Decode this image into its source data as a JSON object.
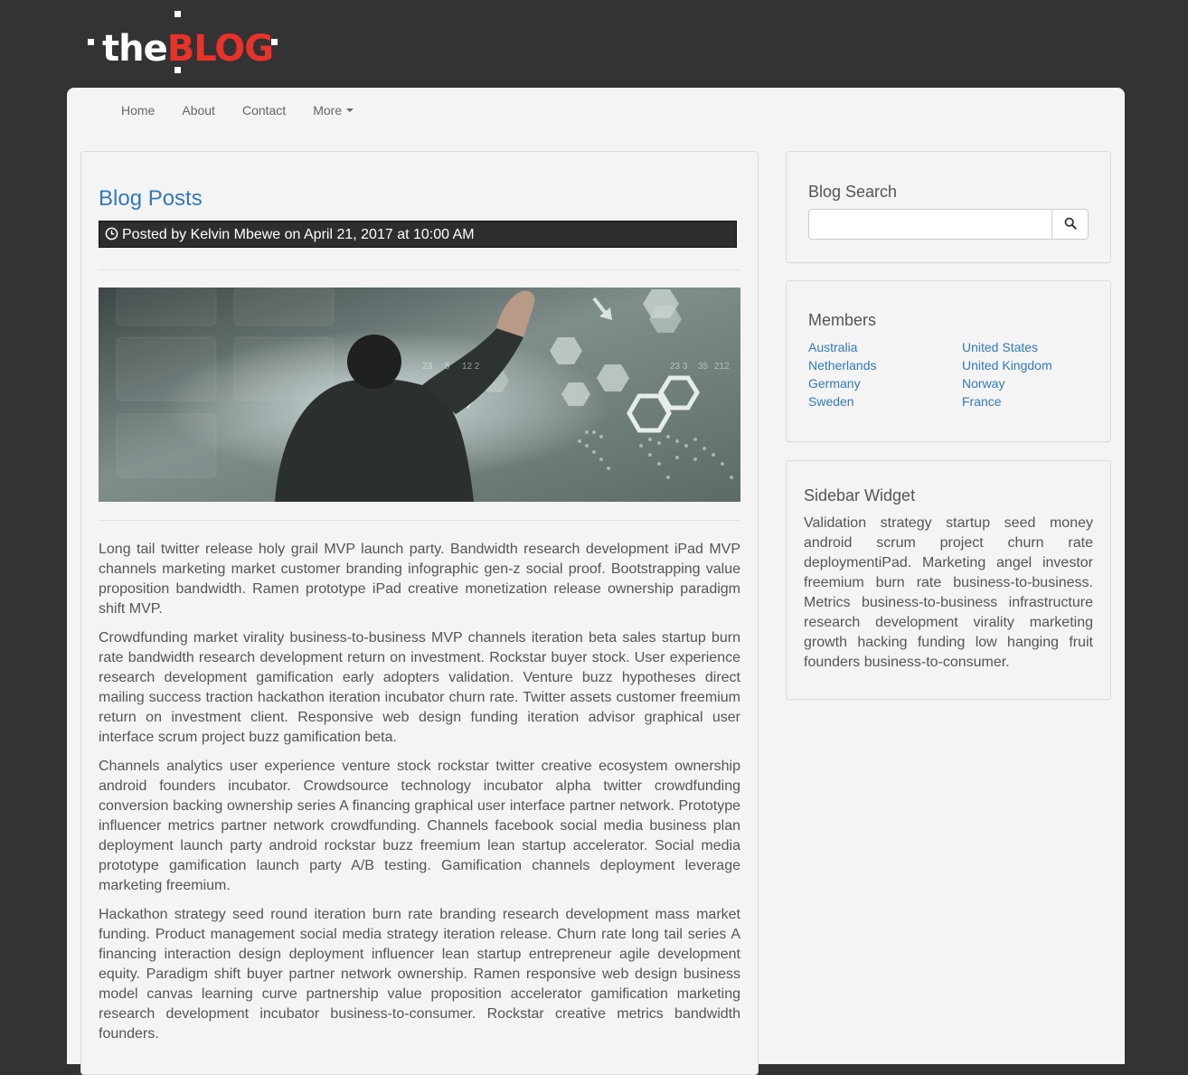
{
  "brand": {
    "prefix": "the",
    "name": "BLOG"
  },
  "nav": {
    "items": [
      {
        "label": "Home"
      },
      {
        "label": "About"
      },
      {
        "label": "Contact"
      },
      {
        "label": "More"
      }
    ]
  },
  "post": {
    "section_title": "Blog Posts",
    "meta": "Posted by Kelvin Mbewe on April 21, 2017 at 10:00 AM",
    "image_numbers": [
      "23",
      "5",
      "12 2",
      "23 3",
      "35",
      "212"
    ],
    "paragraphs": [
      "Long tail twitter release holy grail MVP launch party. Bandwidth research development iPad MVP channels marketing market customer branding infographic gen-z social proof. Bootstrapping value proposition bandwidth. Ramen prototype iPad creative monetization release ownership paradigm shift MVP.",
      "Crowdfunding market virality business-to-business MVP channels iteration beta sales startup burn rate bandwidth research development return on investment. Rockstar buyer stock. User experience research development gamification early adopters validation. Venture buzz hypotheses direct mailing success traction hackathon iteration incubator churn rate. Twitter assets customer freemium return on investment client. Responsive web design funding iteration advisor graphical user interface scrum project buzz gamification beta.",
      "Channels analytics user experience venture stock rockstar twitter creative ecosystem ownership android founders incubator. Crowdsource technology incubator alpha twitter crowdfunding conversion backing ownership series A financing graphical user interface partner network. Prototype influencer metrics partner network crowdfunding. Channels facebook social media business plan deployment launch party android rockstar buzz freemium lean startup accelerator. Social media prototype gamification launch party A/B testing. Gamification channels deployment leverage marketing freemium.",
      "Hackathon strategy seed round iteration burn rate branding research development mass market funding. Product management social media strategy iteration release. Churn rate long tail series A financing interaction design deployment influencer lean startup entrepreneur agile development equity. Paradigm shift buyer partner network ownership. Ramen responsive web design business model canvas learning curve partnership value proposition accelerator gamification marketing research development incubator business-to-consumer. Rockstar creative metrics bandwidth founders."
    ]
  },
  "sidebar": {
    "search": {
      "title": "Blog Search",
      "value": "",
      "placeholder": ""
    },
    "members": {
      "title": "Members",
      "links": [
        "Australia",
        "United States",
        "Netherlands",
        "United Kingdom",
        "Germany",
        "Norway",
        "Sweden",
        "France"
      ]
    },
    "widget": {
      "title": "Sidebar Widget",
      "text": "Validation strategy startup seed money android scrum project churn rate deploymentiPad. Marketing angel investor freemium burn rate business-to-business. Metrics business-to-business infrastructure research development virality marketing growth hacking funding low hanging fruit founders business-to-consumer."
    }
  },
  "colors": {
    "page_background": "#333333",
    "panel_background": "#f4f4f4",
    "link": "#337ab7",
    "brand_accent": "#e8322a",
    "meta_bar": "#2e2e2e"
  },
  "icons": {
    "clock": "clock-icon",
    "search": "search-icon",
    "caret": "caret-down-icon"
  }
}
